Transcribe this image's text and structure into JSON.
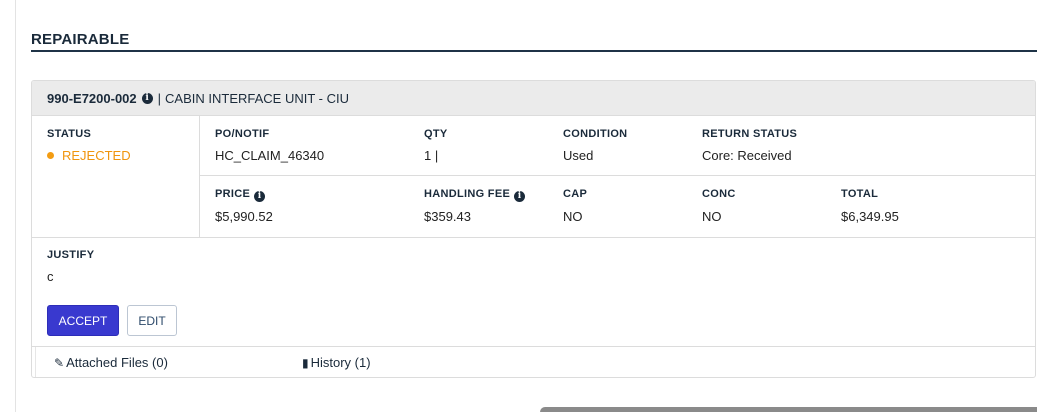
{
  "section": {
    "title": "REPAIRABLE"
  },
  "card": {
    "part_number": "990-E7200-002",
    "separator": "|",
    "description": "CABIN INTERFACE UNIT - CIU",
    "status": {
      "label": "STATUS",
      "value": "REJECTED",
      "color": "#f39c12"
    },
    "row1": {
      "po_notif": {
        "label": "PO/NOTIF",
        "value": "HC_CLAIM_46340"
      },
      "qty": {
        "label": "QTY",
        "value": "1 |"
      },
      "condition": {
        "label": "CONDITION",
        "value": "Used"
      },
      "return_status": {
        "label": "RETURN STATUS",
        "value": "Core: Received"
      }
    },
    "row2": {
      "price": {
        "label": "PRICE",
        "value": "$5,990.52"
      },
      "handling_fee": {
        "label": "HANDLING FEE",
        "value": "$359.43"
      },
      "cap": {
        "label": "CAP",
        "value": "NO"
      },
      "conc": {
        "label": "CONC",
        "value": "NO"
      },
      "total": {
        "label": "TOTAL",
        "value": "$6,349.95"
      }
    },
    "justify": {
      "label": "JUSTIFY",
      "value": "c"
    },
    "buttons": {
      "accept": "ACCEPT",
      "edit": "EDIT"
    },
    "tabs": {
      "attached_files": "Attached Files (0)",
      "history": "History (1)"
    },
    "icons": {
      "info": "info-circle-icon",
      "paperclip": "paperclip-icon",
      "book": "book-icon"
    },
    "accent_color": "#3939cf"
  }
}
